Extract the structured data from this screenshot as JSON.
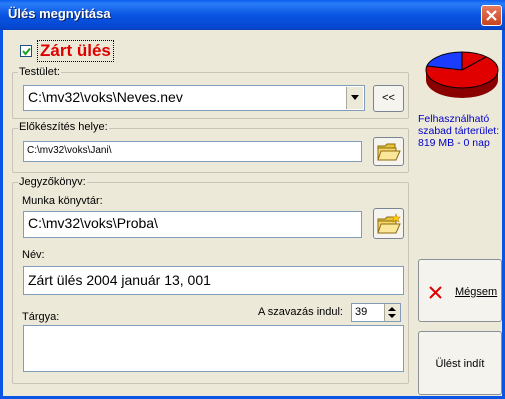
{
  "window": {
    "title": "Ülés megnyitása",
    "close_icon": "close-icon"
  },
  "closed_session": {
    "label": "Zárt ülés",
    "checked": true
  },
  "body_group": {
    "label": "Testület:",
    "value": "C:\\mv32\\voks\\Neves.nev",
    "back_button_label": "<<"
  },
  "prep_group": {
    "label": "Előkészítés helye:",
    "value": "C:\\mv32\\voks\\Jani\\"
  },
  "minutes_group": {
    "label": "Jegyzőkönyv:",
    "workdir_label": "Munka könyvtár:",
    "workdir_value": "C:\\mv32\\voks\\Proba\\",
    "name_label": "Név:",
    "name_value": "Zárt ülés 2004 január 13, 001",
    "subject_label": "Tárgya:",
    "subject_value": "",
    "vote_start_label": "A szavazás indul:",
    "vote_start_value": "39"
  },
  "disk": {
    "line1": "Felhasználható",
    "line2": "szabad tárterület:",
    "line3": "819 MB - 0 nap",
    "used_color": "#e00000",
    "free_color": "#1a3cff"
  },
  "actions": {
    "cancel_label": "Mégsem",
    "start_label": "Ülést indít"
  }
}
